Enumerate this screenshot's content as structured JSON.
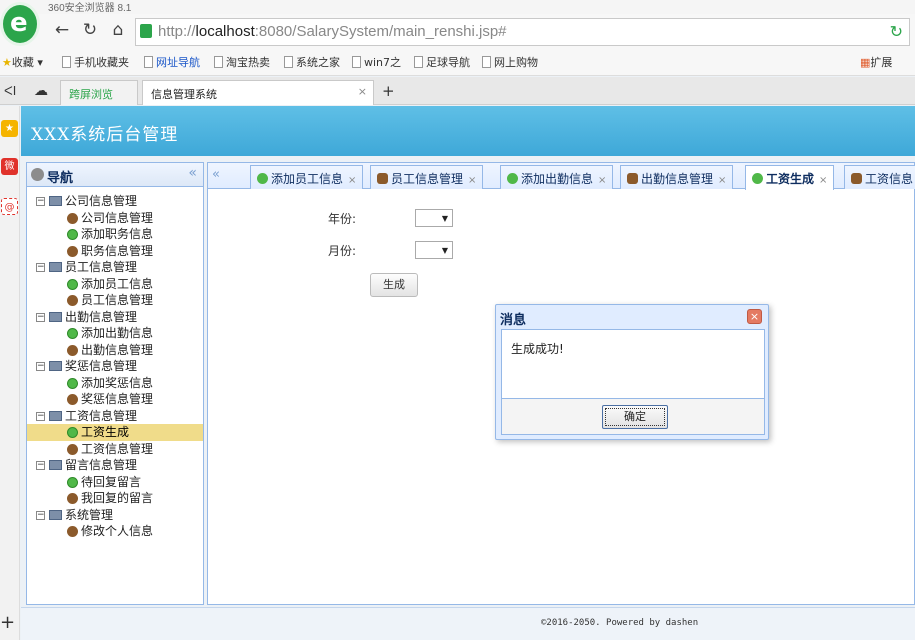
{
  "browser": {
    "title": "360安全浏览器 8.1",
    "url_prefix": "http://",
    "url_host": "localhost",
    "url_rest": ":8080/SalarySystem/main_renshi.jsp#",
    "bookmarks": [
      "收藏",
      "手机收藏夹",
      "网址导航",
      "淘宝热卖",
      "系统之家",
      "win7之",
      "足球导航",
      "网上购物",
      "扩展"
    ],
    "tabs": [
      "跨屏浏览",
      "信息管理系统"
    ]
  },
  "app": {
    "title": "XXX系统后台管理",
    "footer": "©2016-2050. Powered by dashen"
  },
  "nav": {
    "title": "导航",
    "groups": [
      {
        "label": "公司信息管理",
        "items": [
          {
            "label": "公司信息管理",
            "icon": "user"
          },
          {
            "label": "添加职务信息",
            "icon": "add"
          },
          {
            "label": "职务信息管理",
            "icon": "user"
          }
        ]
      },
      {
        "label": "员工信息管理",
        "items": [
          {
            "label": "添加员工信息",
            "icon": "add"
          },
          {
            "label": "员工信息管理",
            "icon": "user"
          }
        ]
      },
      {
        "label": "出勤信息管理",
        "items": [
          {
            "label": "添加出勤信息",
            "icon": "add"
          },
          {
            "label": "出勤信息管理",
            "icon": "user"
          }
        ]
      },
      {
        "label": "奖惩信息管理",
        "items": [
          {
            "label": "添加奖惩信息",
            "icon": "add"
          },
          {
            "label": "奖惩信息管理",
            "icon": "user"
          }
        ]
      },
      {
        "label": "工资信息管理",
        "items": [
          {
            "label": "工资生成",
            "icon": "add",
            "selected": true
          },
          {
            "label": "工资信息管理",
            "icon": "user"
          }
        ]
      },
      {
        "label": "留言信息管理",
        "items": [
          {
            "label": "待回复留言",
            "icon": "add"
          },
          {
            "label": "我回复的留言",
            "icon": "user"
          }
        ]
      },
      {
        "label": "系统管理",
        "items": [
          {
            "label": "修改个人信息",
            "icon": "user"
          }
        ]
      }
    ]
  },
  "main_tabs": [
    {
      "label": "添加员工信息",
      "icon": "add"
    },
    {
      "label": "员工信息管理",
      "icon": "user"
    },
    {
      "label": "添加出勤信息",
      "icon": "add"
    },
    {
      "label": "出勤信息管理",
      "icon": "user"
    },
    {
      "label": "工资生成",
      "icon": "add",
      "active": true
    },
    {
      "label": "工资信息",
      "icon": "user"
    }
  ],
  "form": {
    "year_label": "年份:",
    "month_label": "月份:",
    "generate_label": "生成"
  },
  "dialog": {
    "title": "消息",
    "message": "生成成功!",
    "ok_label": "确定"
  }
}
